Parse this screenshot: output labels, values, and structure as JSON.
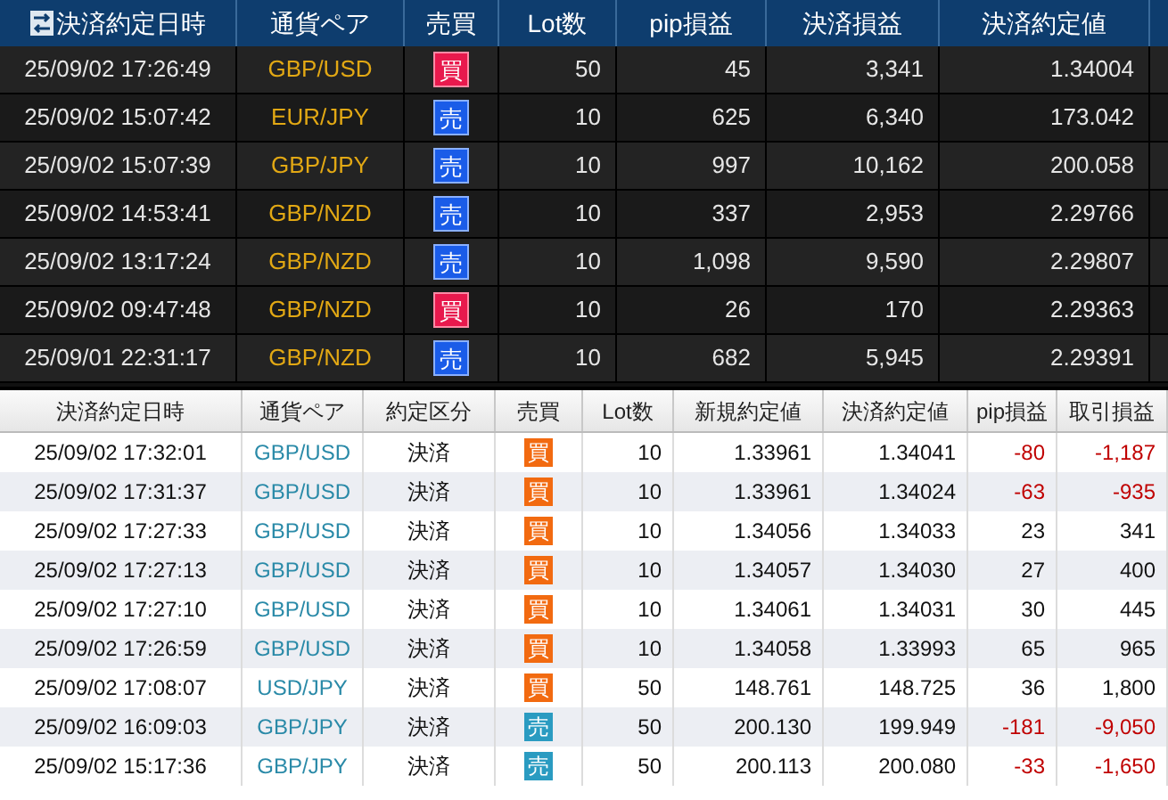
{
  "top_table": {
    "columns": [
      "決済約定日時",
      "通貨ペア",
      "売買",
      "Lot数",
      "pip損益",
      "決済損益",
      "決済約定値"
    ],
    "rows": [
      {
        "datetime": "25/09/02 17:26:49",
        "pair": "GBP/USD",
        "side": {
          "kind": "buy",
          "label": "買"
        },
        "lots": "50",
        "pips": "45",
        "pnl": "3,341",
        "rate": "1.34004"
      },
      {
        "datetime": "25/09/02 15:07:42",
        "pair": "EUR/JPY",
        "side": {
          "kind": "sell",
          "label": "売"
        },
        "lots": "10",
        "pips": "625",
        "pnl": "6,340",
        "rate": "173.042"
      },
      {
        "datetime": "25/09/02 15:07:39",
        "pair": "GBP/JPY",
        "side": {
          "kind": "sell",
          "label": "売"
        },
        "lots": "10",
        "pips": "997",
        "pnl": "10,162",
        "rate": "200.058"
      },
      {
        "datetime": "25/09/02 14:53:41",
        "pair": "GBP/NZD",
        "side": {
          "kind": "sell",
          "label": "売"
        },
        "lots": "10",
        "pips": "337",
        "pnl": "2,953",
        "rate": "2.29766"
      },
      {
        "datetime": "25/09/02 13:17:24",
        "pair": "GBP/NZD",
        "side": {
          "kind": "sell",
          "label": "売"
        },
        "lots": "10",
        "pips": "1,098",
        "pnl": "9,590",
        "rate": "2.29807"
      },
      {
        "datetime": "25/09/02 09:47:48",
        "pair": "GBP/NZD",
        "side": {
          "kind": "buy",
          "label": "買"
        },
        "lots": "10",
        "pips": "26",
        "pnl": "170",
        "rate": "2.29363"
      },
      {
        "datetime": "25/09/01 22:31:17",
        "pair": "GBP/NZD",
        "side": {
          "kind": "sell",
          "label": "売"
        },
        "lots": "10",
        "pips": "682",
        "pnl": "5,945",
        "rate": "2.29391"
      }
    ]
  },
  "bottom_table": {
    "columns": [
      "決済約定日時",
      "通貨ペア",
      "約定区分",
      "売買",
      "Lot数",
      "新規約定値",
      "決済約定値",
      "pip損益",
      "取引損益"
    ],
    "rows": [
      {
        "datetime": "25/09/02 17:32:01",
        "pair": "GBP/USD",
        "type": "決済",
        "side": {
          "kind": "buy",
          "label": "買"
        },
        "lots": "10",
        "open_rate": "1.33961",
        "close_rate": "1.34041",
        "pips": "-80",
        "pnl": "-1,187",
        "loss": true
      },
      {
        "datetime": "25/09/02 17:31:37",
        "pair": "GBP/USD",
        "type": "決済",
        "side": {
          "kind": "buy",
          "label": "買"
        },
        "lots": "10",
        "open_rate": "1.33961",
        "close_rate": "1.34024",
        "pips": "-63",
        "pnl": "-935",
        "loss": true
      },
      {
        "datetime": "25/09/02 17:27:33",
        "pair": "GBP/USD",
        "type": "決済",
        "side": {
          "kind": "buy",
          "label": "買"
        },
        "lots": "10",
        "open_rate": "1.34056",
        "close_rate": "1.34033",
        "pips": "23",
        "pnl": "341",
        "loss": false
      },
      {
        "datetime": "25/09/02 17:27:13",
        "pair": "GBP/USD",
        "type": "決済",
        "side": {
          "kind": "buy",
          "label": "買"
        },
        "lots": "10",
        "open_rate": "1.34057",
        "close_rate": "1.34030",
        "pips": "27",
        "pnl": "400",
        "loss": false
      },
      {
        "datetime": "25/09/02 17:27:10",
        "pair": "GBP/USD",
        "type": "決済",
        "side": {
          "kind": "buy",
          "label": "買"
        },
        "lots": "10",
        "open_rate": "1.34061",
        "close_rate": "1.34031",
        "pips": "30",
        "pnl": "445",
        "loss": false
      },
      {
        "datetime": "25/09/02 17:26:59",
        "pair": "GBP/USD",
        "type": "決済",
        "side": {
          "kind": "buy",
          "label": "買"
        },
        "lots": "10",
        "open_rate": "1.34058",
        "close_rate": "1.33993",
        "pips": "65",
        "pnl": "965",
        "loss": false
      },
      {
        "datetime": "25/09/02 17:08:07",
        "pair": "USD/JPY",
        "type": "決済",
        "side": {
          "kind": "buy",
          "label": "買"
        },
        "lots": "50",
        "open_rate": "148.761",
        "close_rate": "148.725",
        "pips": "36",
        "pnl": "1,800",
        "loss": false
      },
      {
        "datetime": "25/09/02 16:09:03",
        "pair": "GBP/JPY",
        "type": "決済",
        "side": {
          "kind": "sell",
          "label": "売"
        },
        "lots": "50",
        "open_rate": "200.130",
        "close_rate": "199.949",
        "pips": "-181",
        "pnl": "-9,050",
        "loss": true
      },
      {
        "datetime": "25/09/02 15:17:36",
        "pair": "GBP/JPY",
        "type": "決済",
        "side": {
          "kind": "sell",
          "label": "売"
        },
        "lots": "50",
        "open_rate": "200.113",
        "close_rate": "200.080",
        "pips": "-33",
        "pnl": "-1,650",
        "loss": true
      }
    ]
  }
}
